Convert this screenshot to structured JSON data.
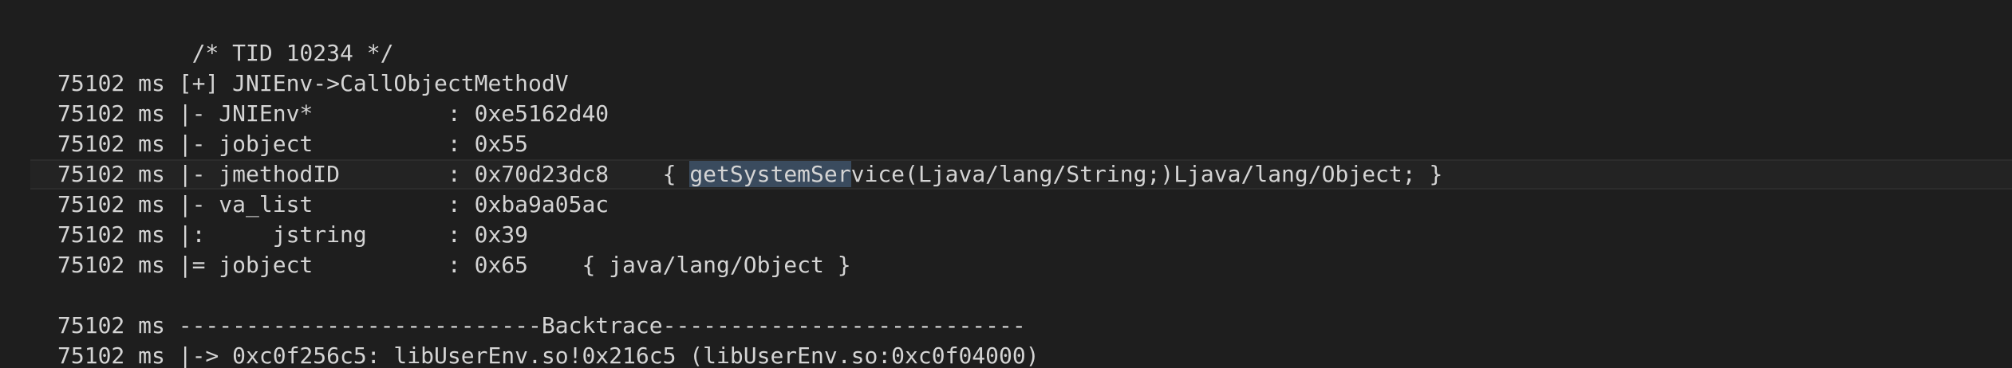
{
  "editor": {
    "lines": [
      {
        "text": "          /* TID 10234 */",
        "kind": "text"
      },
      {
        "text": "75102 ms [+] JNIEnv->CallObjectMethodV",
        "kind": "text"
      },
      {
        "text": "75102 ms |- JNIEnv*          : 0xe5162d40",
        "kind": "text"
      },
      {
        "text": "75102 ms |- jobject          : 0x55",
        "kind": "text"
      },
      {
        "text_before": "75102 ms |- jmethodID        : 0x70d23dc8    { ",
        "selected": "getSystemSer",
        "text_after": "vice(Ljava/lang/String;)Ljava/lang/Object; }",
        "kind": "current"
      },
      {
        "text": "75102 ms |- va_list          : 0xba9a05ac",
        "kind": "text"
      },
      {
        "text": "75102 ms |:     jstring      : 0x39",
        "kind": "text"
      },
      {
        "text": "75102 ms |= jobject          : 0x65    { java/lang/Object }",
        "kind": "text"
      },
      {
        "text": "",
        "kind": "blank"
      },
      {
        "text": "75102 ms ---------------------------Backtrace---------------------------",
        "kind": "text"
      },
      {
        "text": "75102 ms |-> 0xc0f256c5: libUserEnv.so!0x216c5 (libUserEnv.so:0xc0f04000)",
        "kind": "text"
      }
    ]
  }
}
